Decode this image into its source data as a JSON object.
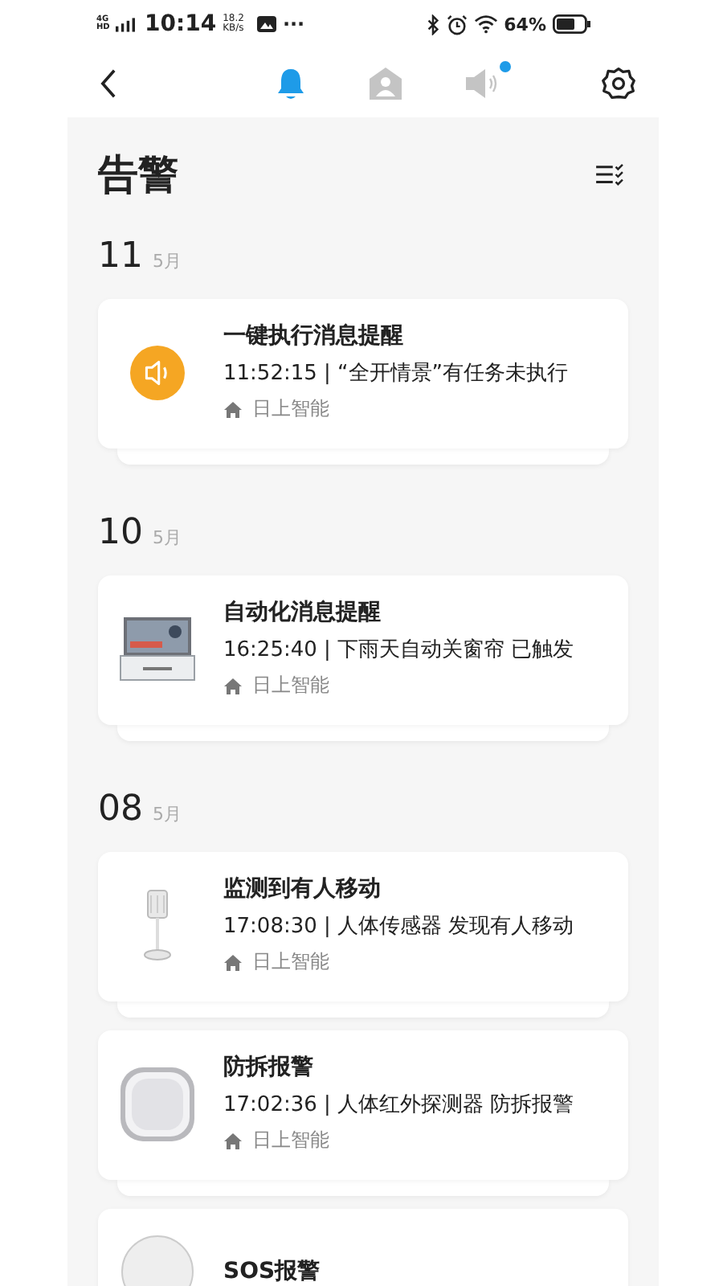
{
  "status_bar": {
    "network": "4G HD",
    "time": "10:14",
    "speed_value": "18.2",
    "speed_unit": "KB/s",
    "more": "···",
    "battery": "64%"
  },
  "tabs": [
    {
      "kind": "bell",
      "selected": true,
      "badge": false
    },
    {
      "kind": "home",
      "selected": false,
      "badge": false
    },
    {
      "kind": "speaker",
      "selected": false,
      "badge": true
    }
  ],
  "title": "告警",
  "groups": [
    {
      "day": "11",
      "month": "5月",
      "alerts": [
        {
          "kind": "speaker",
          "title": "一键执行消息提醒",
          "detail": "11:52:15 | “全开情景”有任务未执行",
          "home": "日上智能"
        }
      ]
    },
    {
      "day": "10",
      "month": "5月",
      "alerts": [
        {
          "kind": "hub",
          "title": "自动化消息提醒",
          "detail": "16:25:40 | 下雨天自动关窗帘 已触发",
          "home": "日上智能"
        }
      ]
    },
    {
      "day": "08",
      "month": "5月",
      "alerts": [
        {
          "kind": "sensor",
          "title": "监测到有人移动",
          "detail": "17:08:30 | 人体传感器 发现有人移动",
          "home": "日上智能"
        },
        {
          "kind": "detector",
          "title": "防拆报警",
          "detail": "17:02:36 | 人体红外探测器 防拆报警",
          "home": "日上智能"
        },
        {
          "kind": "round",
          "title": "SOS报警"
        }
      ]
    }
  ]
}
